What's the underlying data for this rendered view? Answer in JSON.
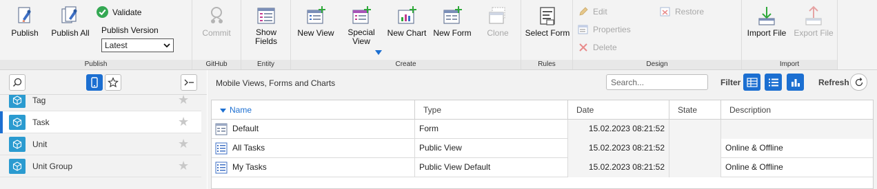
{
  "ribbon": {
    "publish": {
      "publish_label": "Publish",
      "publish_all_label": "Publish All",
      "validate_label": "Validate",
      "version_label": "Publish Version",
      "version_value": "Latest",
      "group_label": "Publish"
    },
    "github": {
      "commit_label": "Commit",
      "group_label": "GitHub"
    },
    "entity": {
      "show_fields_line1": "Show",
      "show_fields_line2": "Fields",
      "group_label": "Entity"
    },
    "create": {
      "new_view_label": "New View",
      "special_view_line1": "Special",
      "special_view_line2": "View",
      "new_chart_label": "New Chart",
      "new_form_label": "New Form",
      "clone_label": "Clone",
      "group_label": "Create"
    },
    "rules": {
      "select_form_label": "Select Form",
      "group_label": "Rules"
    },
    "design": {
      "edit_label": "Edit",
      "properties_label": "Properties",
      "delete_label": "Delete",
      "restore_label": "Restore",
      "group_label": "Design"
    },
    "import": {
      "import_file_label": "Import File",
      "export_file_label": "Export File",
      "group_label": "Import"
    }
  },
  "sidebar": {
    "items": [
      {
        "name": "Tag",
        "selected": false
      },
      {
        "name": "Task",
        "selected": true
      },
      {
        "name": "Unit",
        "selected": false
      },
      {
        "name": "Unit Group",
        "selected": false
      }
    ]
  },
  "main": {
    "title": "Mobile Views, Forms and Charts",
    "search_placeholder": "Search...",
    "filter_label": "Filter",
    "refresh_label": "Refresh",
    "columns": [
      "Name",
      "Type",
      "Date",
      "State",
      "Description"
    ],
    "rows": [
      {
        "icon": "form-icon",
        "name": "Default",
        "type": "Form",
        "date": "15.02.2023 08:21:52",
        "state": "",
        "description": ""
      },
      {
        "icon": "view-icon",
        "name": "All Tasks",
        "type": "Public View",
        "date": "15.02.2023 08:21:52",
        "state": "",
        "description": "Online & Offline"
      },
      {
        "icon": "view-icon",
        "name": "My Tasks",
        "type": "Public View Default",
        "date": "15.02.2023 08:21:52",
        "state": "",
        "description": "Online & Offline"
      }
    ]
  },
  "colors": {
    "accent": "#1c6fd1",
    "entity_icon": "#2b9bd0",
    "validate_green": "#34a853"
  }
}
